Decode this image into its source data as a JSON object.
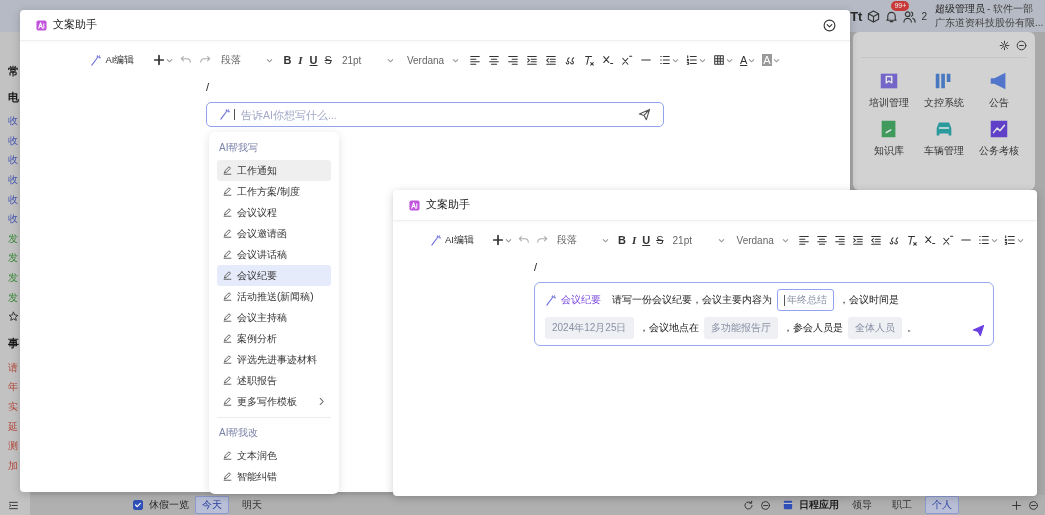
{
  "app_header": {
    "font_button": "Tt",
    "notification_count": "99+",
    "online_count": "2",
    "user_name": "超级管理员",
    "department": "- 软件一部",
    "company": "广东道资科技股份有限..."
  },
  "sidebar": {
    "items": [
      {
        "kind": "heading",
        "label": "常"
      },
      {
        "kind": "heading",
        "label": "电"
      },
      {
        "kind": "received",
        "label": "收"
      },
      {
        "kind": "received",
        "label": "收"
      },
      {
        "kind": "received",
        "label": "收"
      },
      {
        "kind": "received",
        "label": "收"
      },
      {
        "kind": "received",
        "label": "收"
      },
      {
        "kind": "received",
        "label": "收"
      },
      {
        "kind": "sent",
        "label": "发"
      },
      {
        "kind": "sent",
        "label": "发"
      },
      {
        "kind": "sent",
        "label": "发"
      },
      {
        "kind": "sent",
        "label": "发"
      },
      {
        "kind": "favorite"
      },
      {
        "kind": "heading",
        "label": "事"
      },
      {
        "kind": "task",
        "label": "请"
      },
      {
        "kind": "task",
        "label": "年"
      },
      {
        "kind": "task",
        "label": "实"
      },
      {
        "kind": "task",
        "label": "延"
      },
      {
        "kind": "task",
        "label": "测"
      },
      {
        "kind": "task",
        "label": "加"
      }
    ]
  },
  "apps_panel": {
    "apps": [
      {
        "kind": "book",
        "label": "培训管理",
        "color": "#7466c8"
      },
      {
        "kind": "files",
        "label": "文控系统",
        "color": "#4a78c0"
      },
      {
        "kind": "megaphone",
        "label": "公告",
        "color": "#5275cc"
      },
      {
        "kind": "notebook",
        "label": "知识库",
        "color": "#3f9a5c"
      },
      {
        "kind": "car",
        "label": "车辆管理",
        "color": "#2a9a9c"
      },
      {
        "kind": "pen",
        "label": "公务考核",
        "color": "#6040c8"
      }
    ]
  },
  "bottom_bar": {
    "vacation": {
      "label": "休假一览",
      "checked": true
    },
    "day_tabs": [
      {
        "label": "今天",
        "selected": true
      },
      {
        "label": "明天",
        "selected": false
      }
    ],
    "schedule": {
      "label": "日程应用"
    },
    "scope_tabs": [
      {
        "label": "领导",
        "selected": false
      },
      {
        "label": "职工",
        "selected": false
      },
      {
        "label": "个人",
        "selected": true
      }
    ]
  },
  "editor_dialog": {
    "title": "文案助手",
    "toolbar": [
      {
        "kind": "ai",
        "label": "AI编辑"
      },
      {
        "kind": "plus"
      },
      {
        "kind": "undo"
      },
      {
        "kind": "redo"
      },
      {
        "kind": "select",
        "label": "段落"
      },
      {
        "kind": "bold",
        "label": "B"
      },
      {
        "kind": "italic",
        "label": "I"
      },
      {
        "kind": "underline",
        "label": "U"
      },
      {
        "kind": "strike",
        "label": "S"
      },
      {
        "kind": "select",
        "label": "21pt"
      },
      {
        "kind": "select",
        "label": "Verdana"
      },
      {
        "kind": "align-left"
      },
      {
        "kind": "align-center"
      },
      {
        "kind": "align-right"
      },
      {
        "kind": "indent"
      },
      {
        "kind": "outdent"
      },
      {
        "kind": "quote"
      },
      {
        "kind": "clear-format"
      },
      {
        "kind": "subscript"
      },
      {
        "kind": "superscript"
      },
      {
        "kind": "horizontal-rule"
      },
      {
        "kind": "bullet-list"
      },
      {
        "kind": "numbered-list"
      },
      {
        "kind": "table"
      },
      {
        "kind": "font-color",
        "label": "A"
      },
      {
        "kind": "highlight",
        "label": "A"
      }
    ],
    "content": "/",
    "prompt": {
      "placeholder": "告诉AI你想写什么..."
    },
    "menu": {
      "sections": [
        {
          "title": "AI帮我写",
          "items": [
            {
              "label": "工作通知",
              "hovered": true,
              "selected": false,
              "submenu": false
            },
            {
              "label": "工作方案/制度",
              "hovered": false,
              "selected": false,
              "submenu": false
            },
            {
              "label": "会议议程",
              "hovered": false,
              "selected": false,
              "submenu": false
            },
            {
              "label": "会议邀请函",
              "hovered": false,
              "selected": false,
              "submenu": false
            },
            {
              "label": "会议讲话稿",
              "hovered": false,
              "selected": false,
              "submenu": false
            },
            {
              "label": "会议纪要",
              "hovered": false,
              "selected": true,
              "submenu": false
            },
            {
              "label": "活动推送(新闻稿)",
              "hovered": false,
              "selected": false,
              "submenu": false
            },
            {
              "label": "会议主持稿",
              "hovered": false,
              "selected": false,
              "submenu": false
            },
            {
              "label": "案例分析",
              "hovered": false,
              "selected": false,
              "submenu": false
            },
            {
              "label": "评选先进事迹材料",
              "hovered": false,
              "selected": false,
              "submenu": false
            },
            {
              "label": "述职报告",
              "hovered": false,
              "selected": false,
              "submenu": false
            },
            {
              "label": "更多写作模板",
              "hovered": false,
              "selected": false,
              "submenu": true
            }
          ]
        },
        {
          "title": "AI帮我改",
          "items": [
            {
              "label": "文本润色",
              "hovered": false,
              "selected": false,
              "submenu": false
            },
            {
              "label": "智能纠错",
              "hovered": false,
              "selected": false,
              "submenu": false
            }
          ]
        }
      ]
    }
  },
  "prompt_dialog": {
    "title": "文案助手",
    "toolbar": [
      {
        "kind": "ai",
        "label": "AI编辑"
      },
      {
        "kind": "plus"
      },
      {
        "kind": "undo"
      },
      {
        "kind": "redo"
      },
      {
        "kind": "select",
        "label": "段落"
      },
      {
        "kind": "bold",
        "label": "B"
      },
      {
        "kind": "italic",
        "label": "I"
      },
      {
        "kind": "underline",
        "label": "U"
      },
      {
        "kind": "strike",
        "label": "S"
      },
      {
        "kind": "select",
        "label": "21pt"
      },
      {
        "kind": "select",
        "label": "Verdana"
      },
      {
        "kind": "align-left"
      },
      {
        "kind": "align-center"
      },
      {
        "kind": "align-right"
      },
      {
        "kind": "indent"
      },
      {
        "kind": "outdent"
      },
      {
        "kind": "quote"
      },
      {
        "kind": "clear-format"
      },
      {
        "kind": "subscript"
      },
      {
        "kind": "superscript"
      },
      {
        "kind": "horizontal-rule"
      },
      {
        "kind": "bullet-list"
      },
      {
        "kind": "numbered-list"
      }
    ],
    "content": "/",
    "prompt": {
      "tag": "会议纪要",
      "segments": [
        {
          "kind": "text",
          "text": "请写一份会议纪要，会议主要内容为"
        },
        {
          "kind": "field",
          "value": "年终总结",
          "focused": true
        },
        {
          "kind": "text",
          "text": "，会议时间是"
        },
        {
          "kind": "field",
          "value": "2024年12月25日",
          "focused": false
        },
        {
          "kind": "text",
          "text": "，会议地点在"
        },
        {
          "kind": "field",
          "value": "多功能报告厅",
          "focused": false
        },
        {
          "kind": "text",
          "text": "，参会人员是"
        },
        {
          "kind": "field",
          "value": "全体人员",
          "focused": false
        },
        {
          "kind": "text",
          "text": "。"
        }
      ]
    }
  }
}
